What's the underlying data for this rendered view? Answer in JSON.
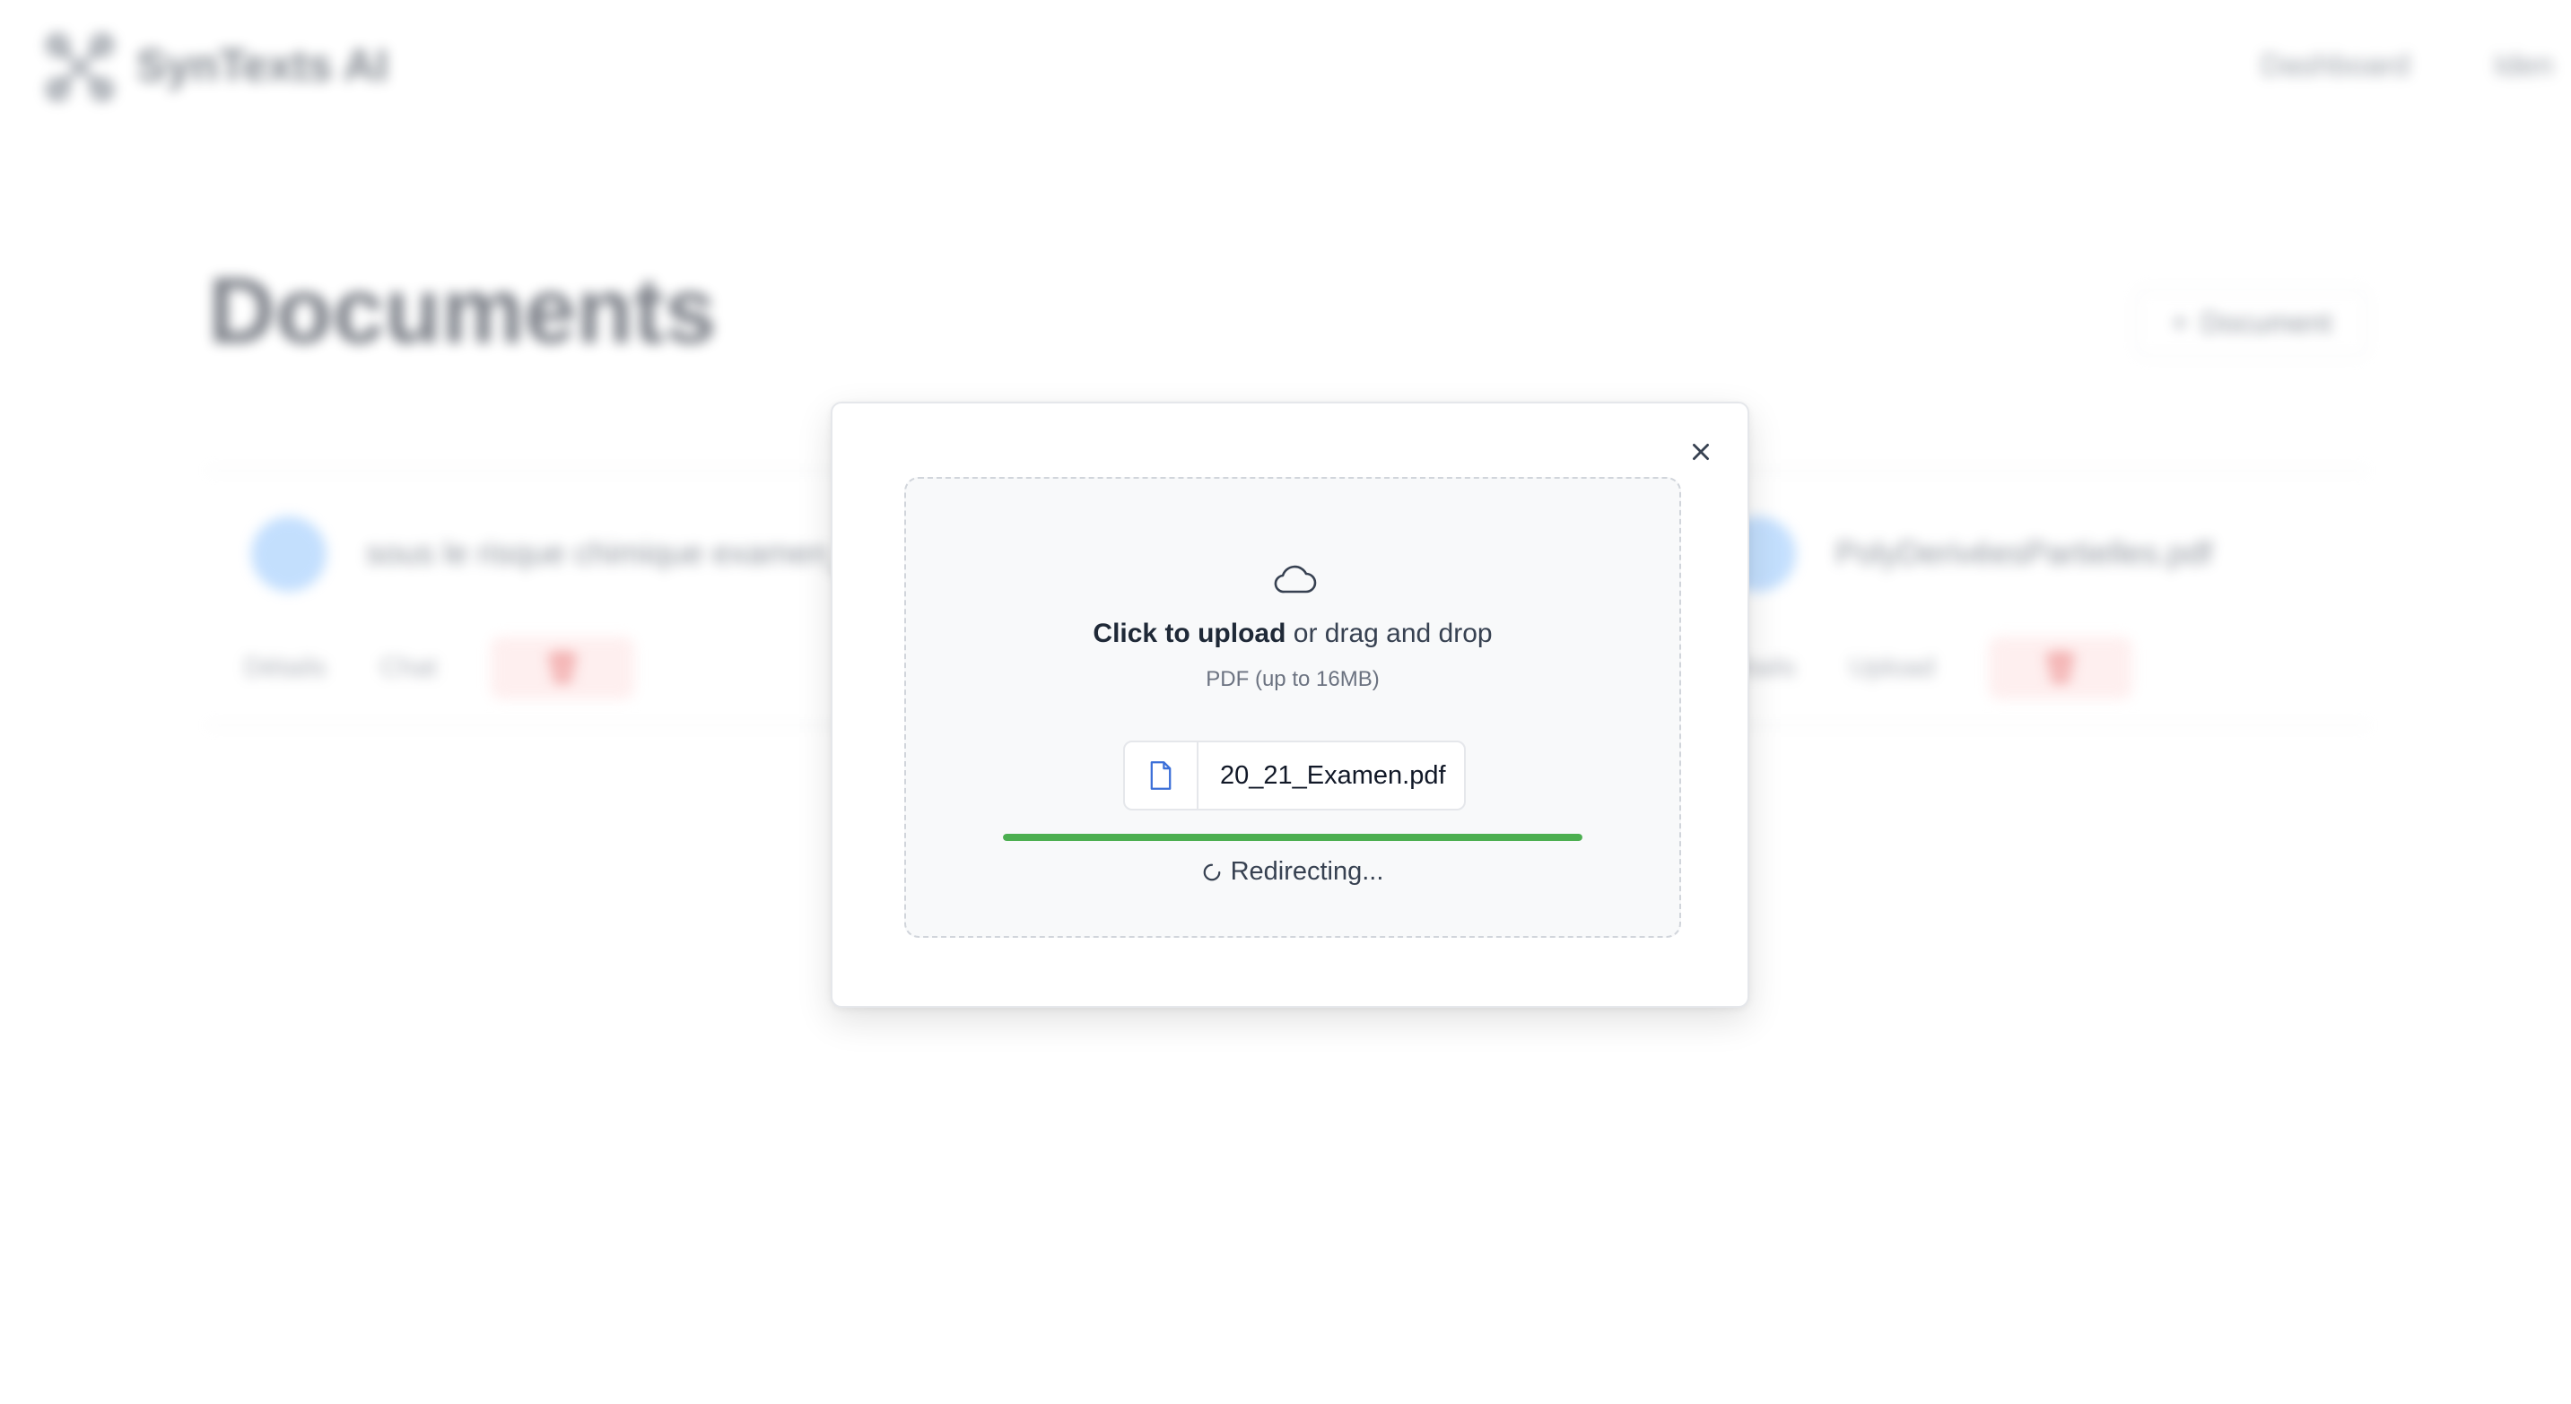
{
  "app": {
    "brand": "SynTexts AI",
    "nav": {
      "dashboard": "Dashboard",
      "user": "Iden"
    }
  },
  "page": {
    "title": "Documents",
    "new_document_label": "Document",
    "documents": [
      {
        "name": "sous le risque chimique examen_",
        "actions": {
          "details": "Détails",
          "chat": "Chat"
        }
      },
      {
        "name": "PolyDerivéesPartielles.pdf",
        "actions": {
          "details": "Détails",
          "chat": "Upload"
        }
      }
    ]
  },
  "modal": {
    "close_icon": "close-icon",
    "dropzone": {
      "icon": "cloud-icon",
      "click_label": "Click to upload",
      "drag_label": " or drag and drop",
      "hint": "PDF (up to 16MB)"
    },
    "file": {
      "icon": "file-icon",
      "name": "20_21_Examen.pdf"
    },
    "progress": {
      "value": 1.0,
      "color": "#4caf50"
    },
    "status": {
      "icon": "spinner-icon",
      "text": "Redirecting..."
    }
  }
}
